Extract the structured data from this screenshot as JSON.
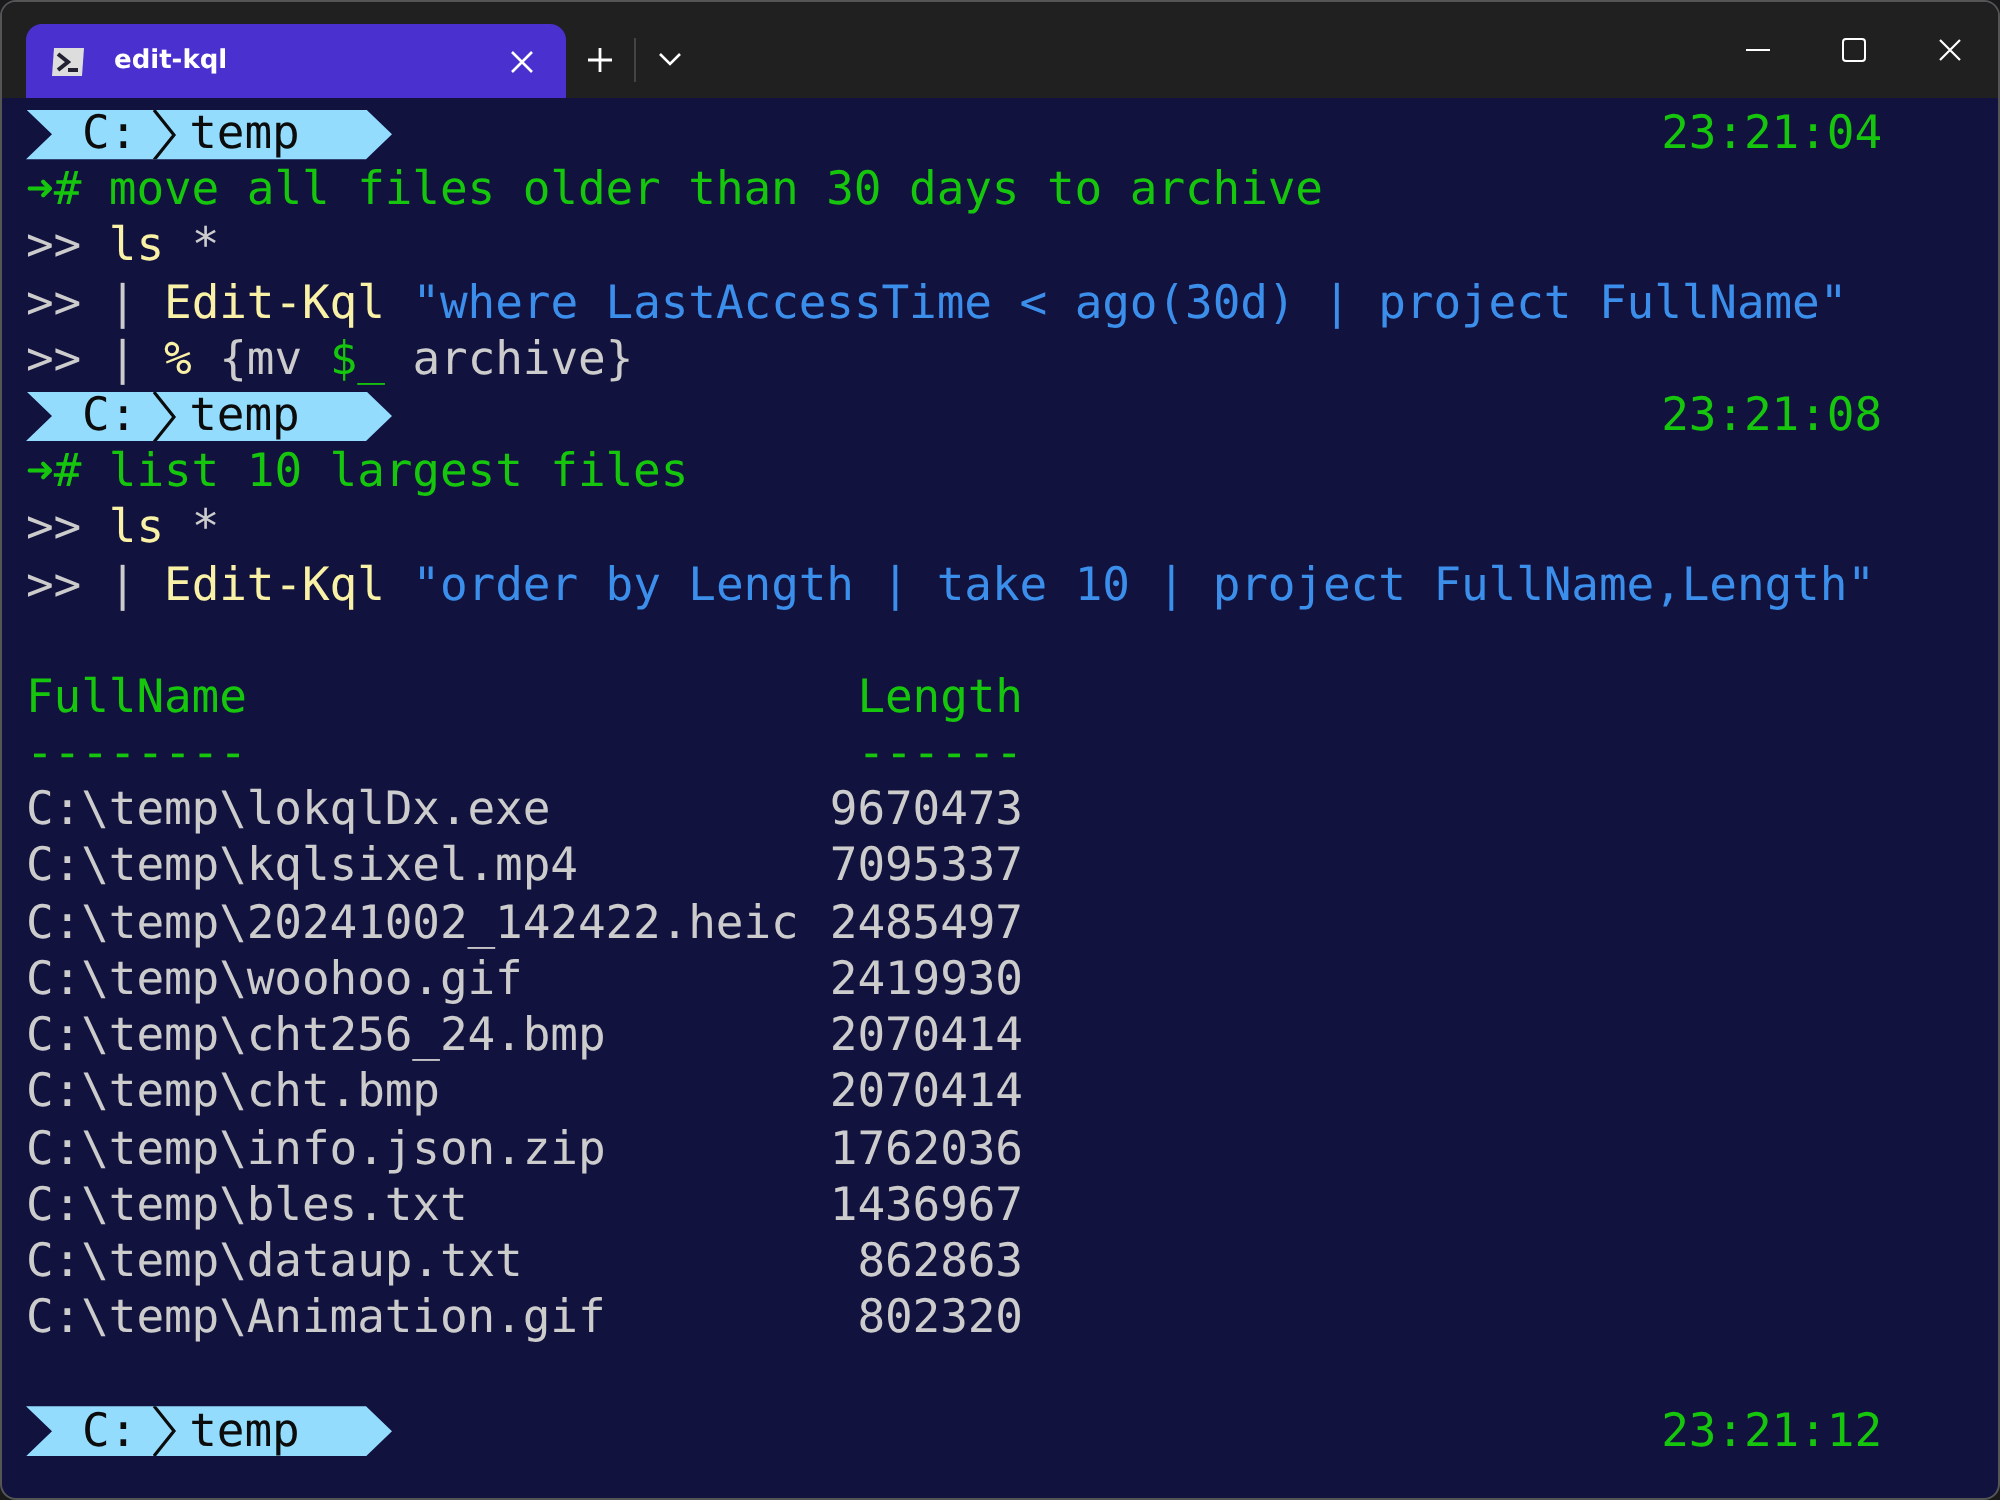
{
  "tab": {
    "title": "edit-kql",
    "selected": true
  },
  "lines": [
    {
      "kind": "prompt",
      "drive": "C:",
      "folder": "temp",
      "time": "23:21:04"
    },
    {
      "kind": "input",
      "segments": [
        {
          "kind": "arrow",
          "text": "➜"
        },
        {
          "kind": "comment",
          "text": "# move all files older than 30 days to archive"
        }
      ]
    },
    {
      "kind": "input",
      "segments": [
        {
          "kind": "marker",
          "text": ">>"
        },
        {
          "kind": "command",
          "text": " ls"
        },
        {
          "kind": "plain",
          "text": " *"
        }
      ]
    },
    {
      "kind": "input",
      "segments": [
        {
          "kind": "marker",
          "text": ">>"
        },
        {
          "kind": "plain",
          "text": " |"
        },
        {
          "kind": "command",
          "text": " Edit-Kql"
        },
        {
          "kind": "string",
          "text": " \"where LastAccessTime < ago(30d) | project FullName\""
        }
      ]
    },
    {
      "kind": "input",
      "segments": [
        {
          "kind": "marker",
          "text": ">>"
        },
        {
          "kind": "plain",
          "text": " | "
        },
        {
          "kind": "command",
          "text": "%"
        },
        {
          "kind": "plain",
          "text": " {mv "
        },
        {
          "kind": "variable",
          "text": "$_"
        },
        {
          "kind": "plain",
          "text": " archive}"
        }
      ]
    },
    {
      "kind": "prompt",
      "drive": "C:",
      "folder": "temp",
      "time": "23:21:08"
    },
    {
      "kind": "input",
      "segments": [
        {
          "kind": "arrow",
          "text": "➜"
        },
        {
          "kind": "comment",
          "text": "# list 10 largest files"
        }
      ]
    },
    {
      "kind": "input",
      "segments": [
        {
          "kind": "marker",
          "text": ">>"
        },
        {
          "kind": "command",
          "text": " ls"
        },
        {
          "kind": "plain",
          "text": " *"
        }
      ]
    },
    {
      "kind": "input",
      "segments": [
        {
          "kind": "marker",
          "text": ">>"
        },
        {
          "kind": "plain",
          "text": " |"
        },
        {
          "kind": "command",
          "text": " Edit-Kql"
        },
        {
          "kind": "string",
          "text": " \"order by Length | take 10 | project FullName,Length\""
        }
      ]
    },
    {
      "kind": "blank"
    },
    {
      "kind": "table",
      "columns": [
        {
          "name": "FullName",
          "rule": "--------"
        },
        {
          "name": "Length",
          "rule": "------"
        }
      ],
      "rows": [
        [
          "C:\\temp\\lokqlDx.exe",
          "9670473"
        ],
        [
          "C:\\temp\\kqlsixel.mp4",
          "7095337"
        ],
        [
          "C:\\temp\\20241002_142422.heic",
          "2485497"
        ],
        [
          "C:\\temp\\woohoo.gif",
          "2419930"
        ],
        [
          "C:\\temp\\cht256_24.bmp",
          "2070414"
        ],
        [
          "C:\\temp\\cht.bmp",
          "2070414"
        ],
        [
          "C:\\temp\\info.json.zip",
          "1762036"
        ],
        [
          "C:\\temp\\bles.txt",
          "1436967"
        ],
        [
          "C:\\temp\\dataup.txt",
          "862863"
        ],
        [
          "C:\\temp\\Animation.gif",
          "802320"
        ]
      ]
    },
    {
      "kind": "blank"
    },
    {
      "kind": "prompt",
      "drive": "C:",
      "folder": "temp",
      "time": "23:21:12"
    }
  ]
}
